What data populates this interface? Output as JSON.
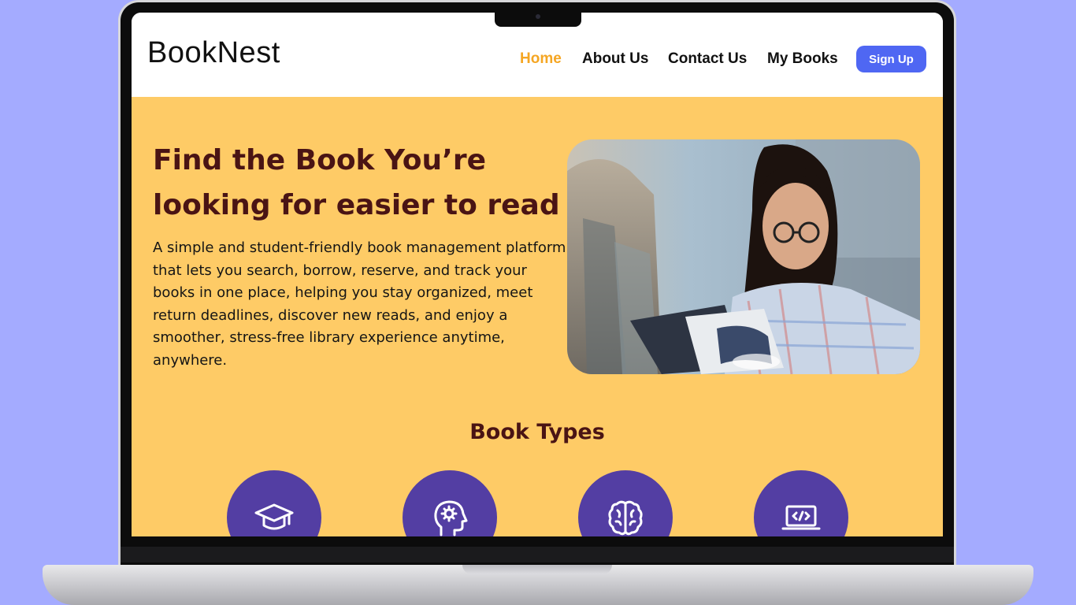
{
  "colors": {
    "background": "#a4abff",
    "hero_bg": "#fecb66",
    "accent_active": "#f5a623",
    "signup_button": "#4f67f3",
    "heading": "#4a1414",
    "category_circle": "#533ea3"
  },
  "nav": {
    "logo": "BookNest",
    "links": [
      {
        "label": "Home",
        "active": true
      },
      {
        "label": "About Us",
        "active": false
      },
      {
        "label": "Contact Us",
        "active": false
      },
      {
        "label": "My Books",
        "active": false
      }
    ],
    "signup_label": "Sign Up"
  },
  "hero": {
    "title": "Find the Book You’re looking for easier to read",
    "description": "A simple and student-friendly book management platform that lets you search, borrow, reserve, and track your books in one place, helping you stay organized, meet return deadlines, discover new reads, and enjoy a smoother, stress-free library experience anytime, anywhere.",
    "image": "woman-reading-book-photo"
  },
  "book_types": {
    "title": "Book Types",
    "items": [
      {
        "icon": "graduation-cap-icon"
      },
      {
        "icon": "head-gear-icon"
      },
      {
        "icon": "brain-icon"
      },
      {
        "icon": "laptop-code-icon"
      }
    ]
  }
}
